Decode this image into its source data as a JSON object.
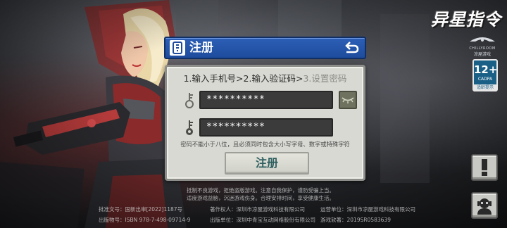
{
  "brand": {
    "game_logo": "异星指令",
    "studio_name": "CHILLYROOM",
    "studio_sub": "凉屋游戏"
  },
  "age_rating": {
    "age": "12+",
    "org": "CADPA",
    "tip": "适龄提示"
  },
  "dialog": {
    "title": "注册",
    "steps": {
      "step1": "1.输入手机号",
      "sep1": ">",
      "step2": "2.输入验证码",
      "sep2": ">",
      "step3": "3.设置密码"
    },
    "password": "**********",
    "confirm_password": "**********",
    "hint": "密码不能小于八位，且必须同时包含大小写字母、数字或特殊字符",
    "submit_label": "注册"
  },
  "footer": {
    "health_line1": "抵制不良游戏，拒绝盗版游戏。注意自我保护，谨防受骗上当。",
    "health_line2": "适度游戏益脑，沉迷游戏伤身。合理安排时间，享受健康生活。",
    "approval_no": "批准文号：国新出审[2022]1187号",
    "copyright_owner": "著作权人：深圳市凉屋游戏科技有限公司",
    "operator": "运营单位：深圳市凉屋游戏科技有限公司",
    "isbn": "出版物号：ISBN 978-7-498-09714-9",
    "publisher": "出版单位：深圳中青宝互动网络股份有限公司",
    "software_reg": "游戏软著：2019SR0583639"
  },
  "colors": {
    "header_blue": "#1e4c9d",
    "panel": "#d8d9d3",
    "input_dark": "#3b3b3b",
    "submit_text": "#2e5f5f",
    "rating_blue": "#1a5f86"
  },
  "icons": {
    "header": "phone-card-icon",
    "back": "return-arrow-icon",
    "password": "key-icon",
    "confirm": "key-icon",
    "toggle": "eye-closed-icon",
    "report": "exclamation-icon",
    "customer_service": "support-agent-icon"
  }
}
